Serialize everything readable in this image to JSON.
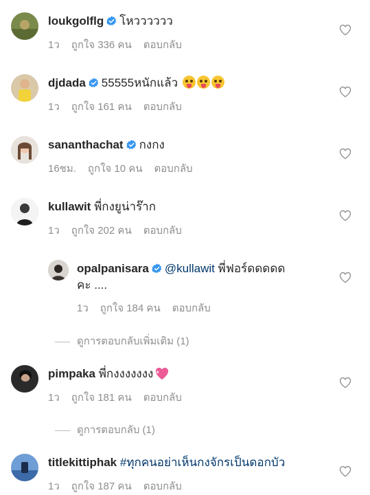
{
  "comments": [
    {
      "username": "loukgolflg",
      "verified": true,
      "text": "โหวววววว",
      "time": "1ว",
      "likes": "ถูกใจ 336 คน",
      "reply": "ตอบกลับ"
    },
    {
      "username": "djdada",
      "verified": true,
      "text": "55555หนักแล้ว",
      "time": "1ว",
      "likes": "ถูกใจ 161 คน",
      "reply": "ตอบกลับ"
    },
    {
      "username": "sananthachat",
      "verified": true,
      "text": "กงกง",
      "time": "16ชม.",
      "likes": "ถูกใจ 10 คน",
      "reply": "ตอบกลับ"
    },
    {
      "username": "kullawit",
      "verified": false,
      "text": "พี่กงยูน่าร๊าก",
      "time": "1ว",
      "likes": "ถูกใจ 202 คน",
      "reply": "ตอบกลับ"
    },
    {
      "username": "pimpaka",
      "verified": false,
      "text": "พี่กงงงงงงง",
      "time": "1ว",
      "likes": "ถูกใจ 181 คน",
      "reply": "ตอบกลับ"
    },
    {
      "username": "titlekittiphak",
      "verified": false,
      "text": "#ทุกคนอย่าเห็นกงจักรเป็นดอกบัว",
      "time": "1ว",
      "likes": "ถูกใจ 187 คน",
      "reply": "ตอบกลับ"
    }
  ],
  "reply": {
    "username": "opalpanisara",
    "verified": true,
    "mention": "@kullawit",
    "text_line1": "พี่ฟอร์ดดดดด",
    "text_line2": "คะ ....",
    "time": "1ว",
    "likes": "ถูกใจ 184 คน",
    "reply": "ตอบกลับ"
  },
  "view_more_1": "ดูการตอบกลับเพิ่มเติม (1)",
  "view_more_2": "ดูการตอบกลับ (1)",
  "colors": {
    "verified": "#3897f0",
    "meta": "#8e8e8e",
    "mention": "#00376b",
    "text": "#262626"
  },
  "icons": [
    "verified-badge-icon",
    "heart-outline-icon",
    "zany-face-emoji",
    "sparkling-heart-emoji"
  ]
}
